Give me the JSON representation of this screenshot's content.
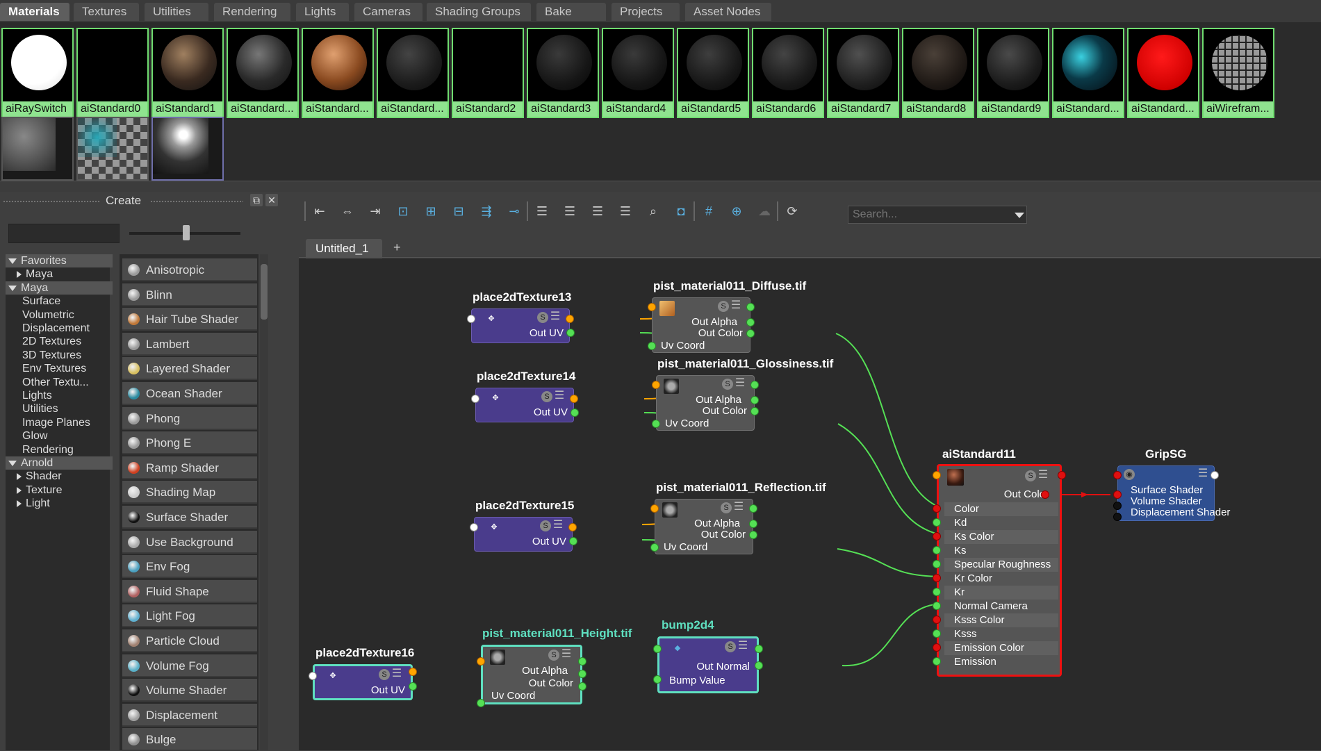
{
  "tabs": [
    "Materials",
    "Textures",
    "Utilities",
    "Rendering",
    "Lights",
    "Cameras",
    "Shading Groups",
    "Bake Sets",
    "Projects",
    "Asset Nodes"
  ],
  "swatches": [
    "aiRaySwitch",
    "aiStandard0",
    "aiStandard1",
    "aiStandard...",
    "aiStandard...",
    "aiStandard...",
    "aiStandard2",
    "aiStandard3",
    "aiStandard4",
    "aiStandard5",
    "aiStandard6",
    "aiStandard7",
    "aiStandard8",
    "aiStandard9",
    "aiStandard...",
    "aiStandard...",
    "aiWirefram..."
  ],
  "create": {
    "title": "Create",
    "tree": [
      {
        "label": "Favorites",
        "type": "hdr",
        "arrow": "down"
      },
      {
        "label": "Maya",
        "type": "item",
        "arrow": "right",
        "indent": 1
      },
      {
        "label": "Maya",
        "type": "hdr",
        "arrow": "down"
      },
      {
        "label": "Surface",
        "type": "item",
        "indent": 2
      },
      {
        "label": "Volumetric",
        "type": "item",
        "indent": 2
      },
      {
        "label": "Displacement",
        "type": "item",
        "indent": 2
      },
      {
        "label": "2D Textures",
        "type": "item",
        "indent": 2
      },
      {
        "label": "3D Textures",
        "type": "item",
        "indent": 2
      },
      {
        "label": "Env Textures",
        "type": "item",
        "indent": 2
      },
      {
        "label": "Other Textu...",
        "type": "item",
        "indent": 2
      },
      {
        "label": "Lights",
        "type": "item",
        "indent": 2
      },
      {
        "label": "Utilities",
        "type": "item",
        "indent": 2
      },
      {
        "label": "Image Planes",
        "type": "item",
        "indent": 2
      },
      {
        "label": "Glow",
        "type": "item",
        "indent": 2
      },
      {
        "label": "Rendering",
        "type": "item",
        "indent": 2
      },
      {
        "label": "Arnold",
        "type": "hdr",
        "arrow": "down"
      },
      {
        "label": "Shader",
        "type": "item",
        "arrow": "right",
        "indent": 1
      },
      {
        "label": "Texture",
        "type": "item",
        "arrow": "right",
        "indent": 1
      },
      {
        "label": "Light",
        "type": "item",
        "arrow": "right",
        "indent": 1
      }
    ],
    "nodes": [
      {
        "label": "Anisotropic",
        "color": "#9a9a9a"
      },
      {
        "label": "Blinn",
        "color": "#9a9a9a"
      },
      {
        "label": "Hair Tube Shader",
        "color": "#c07838"
      },
      {
        "label": "Lambert",
        "color": "#9a9a9a"
      },
      {
        "label": "Layered Shader",
        "color": "#d8c060"
      },
      {
        "label": "Ocean Shader",
        "color": "#2a8aa0"
      },
      {
        "label": "Phong",
        "color": "#9a9a9a"
      },
      {
        "label": "Phong E",
        "color": "#9a9a9a"
      },
      {
        "label": "Ramp Shader",
        "color": "#d04020"
      },
      {
        "label": "Shading Map",
        "color": "#cccccc"
      },
      {
        "label": "Surface Shader",
        "color": "#111111"
      },
      {
        "label": "Use Background",
        "color": "#aaaaaa"
      },
      {
        "label": "Env Fog",
        "color": "#4aa0c0"
      },
      {
        "label": "Fluid Shape",
        "color": "#b06060"
      },
      {
        "label": "Light Fog",
        "color": "#60b0d0"
      },
      {
        "label": "Particle Cloud",
        "color": "#a08070"
      },
      {
        "label": "Volume Fog",
        "color": "#5ab0c8"
      },
      {
        "label": "Volume Shader",
        "color": "#111111"
      },
      {
        "label": "Displacement",
        "color": "#a0a0a0"
      },
      {
        "label": "Bulge",
        "color": "#909090"
      }
    ]
  },
  "editor": {
    "search_placeholder": "Search...",
    "tab": "Untitled_1",
    "add_tab": "+"
  },
  "graph": {
    "p13": {
      "title": "place2dTexture13",
      "out": "Out UV"
    },
    "p14": {
      "title": "place2dTexture14",
      "out": "Out UV"
    },
    "p15": {
      "title": "place2dTexture15",
      "out": "Out UV"
    },
    "p16": {
      "title": "place2dTexture16",
      "out": "Out UV"
    },
    "diffuse": {
      "title": "pist_material011_Diffuse.tif",
      "alpha": "Out Alpha",
      "color": "Out Color",
      "uv": "Uv Coord"
    },
    "gloss": {
      "title": "pist_material011_Glossiness.tif",
      "alpha": "Out Alpha",
      "color": "Out Color",
      "uv": "Uv Coord"
    },
    "refl": {
      "title": "pist_material011_Reflection.tif",
      "alpha": "Out Alpha",
      "color": "Out Color",
      "uv": "Uv Coord"
    },
    "height": {
      "title": "pist_material011_Height.tif",
      "alpha": "Out Alpha",
      "color": "Out Color",
      "uv": "Uv Coord"
    },
    "bump": {
      "title": "bump2d4",
      "out": "Out Normal",
      "in": "Bump Value"
    },
    "ai": {
      "title": "aiStandard11",
      "out": "Out Color",
      "attrs": [
        "Color",
        "Kd",
        "Ks Color",
        "Ks",
        "Specular Roughness",
        "Kr Color",
        "Kr",
        "Normal Camera",
        "Ksss Color",
        "Ksss",
        "Emission Color",
        "Emission"
      ]
    },
    "sg": {
      "title": "GripSG",
      "attrs": [
        "Surface Shader",
        "Volume Shader",
        "Displacement Shader"
      ]
    }
  },
  "colors": {
    "accent_green": "#8fe38f",
    "selected_red": "#ee1111",
    "node_purple": "#4a3c8c",
    "sg_blue": "#2f4f90"
  }
}
